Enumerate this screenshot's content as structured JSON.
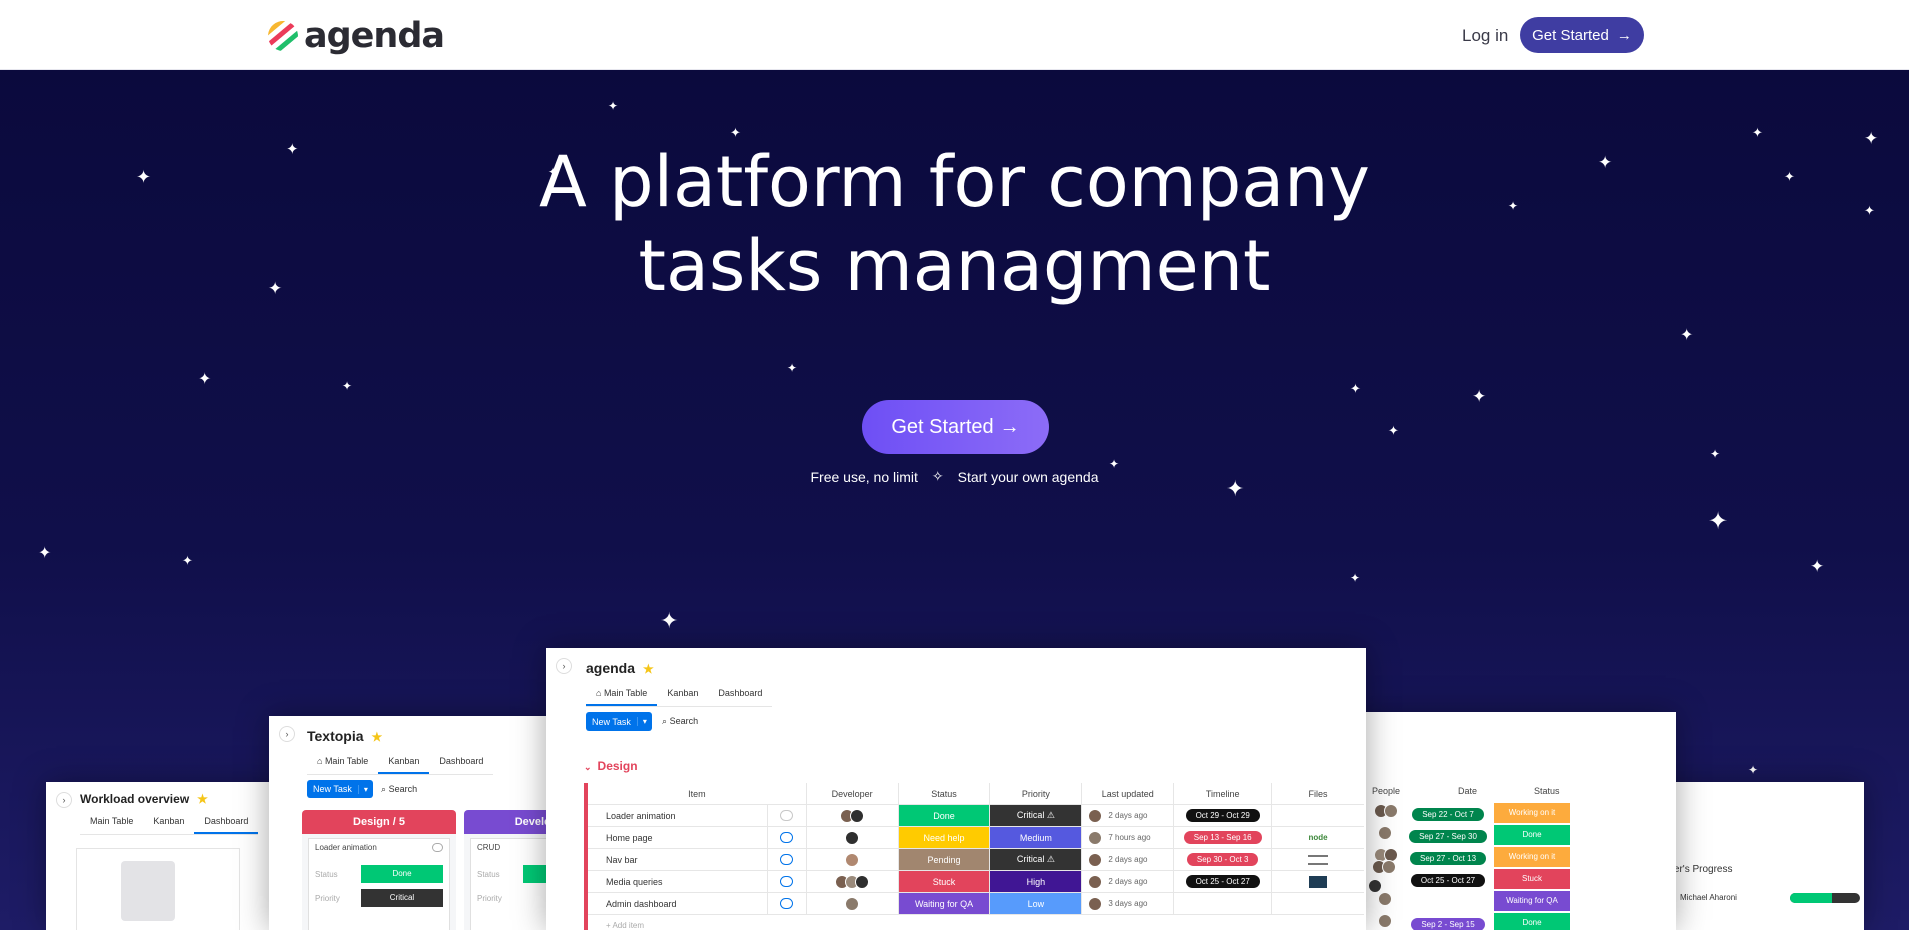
{
  "header": {
    "logo_text": "agenda",
    "login_label": "Log in",
    "cta_label": "Get Started",
    "cta_arrow": "→"
  },
  "hero": {
    "headline_line1": "A platform for company",
    "headline_line2": "tasks managment",
    "cta_label": "Get Started",
    "cta_arrow": "→",
    "sub_left": "Free use, no limit",
    "sub_right": "Start your own agenda"
  },
  "colors": {
    "hero_bg": "#0c0a3e",
    "brand_button": "#3f3da2",
    "hero_button": "#7557f6",
    "group_red": "#e2445c",
    "done_green": "#00c875",
    "stuck_red": "#e2445c",
    "working_orange": "#fdab3d",
    "qa_purple": "#784bd1",
    "critical_dark": "#333333"
  },
  "screen_main": {
    "title": "agenda",
    "tabs": [
      "Main Table",
      "Kanban",
      "Dashboard"
    ],
    "new_task": "New Task",
    "search": "Search",
    "group": "Design",
    "columns": [
      "Item",
      "Developer",
      "Status",
      "Priority",
      "Last updated",
      "Timeline",
      "Files"
    ],
    "rows": [
      {
        "item": "Loader animation",
        "status": "Done",
        "status_color": "#00c875",
        "priority": "Critical ⚠",
        "priority_color": "#333333",
        "updated": "2 days ago",
        "timeline": "Oct 29 - Oct 29",
        "timeline_color": "#111111",
        "file": ""
      },
      {
        "item": "Home page",
        "status": "Need help",
        "status_color": "#ffcb00",
        "priority": "Medium",
        "priority_color": "#5559df",
        "updated": "7 hours ago",
        "timeline": "Sep 13 - Sep 16",
        "timeline_color": "#e2445c",
        "file": "node"
      },
      {
        "item": "Nav bar",
        "status": "Pending",
        "status_color": "#a1866f",
        "priority": "Critical ⚠",
        "priority_color": "#333333",
        "updated": "2 days ago",
        "timeline": "Sep 30 - Oct 3",
        "timeline_color": "#e2445c",
        "file": ""
      },
      {
        "item": "Media queries",
        "status": "Stuck",
        "status_color": "#e2445c",
        "priority": "High",
        "priority_color": "#401694",
        "updated": "2 days ago",
        "timeline": "Oct 25 - Oct 27",
        "timeline_color": "#111111",
        "file": ""
      },
      {
        "item": "Admin dashboard",
        "status": "Waiting for QA",
        "status_color": "#784bd1",
        "priority": "Low",
        "priority_color": "#579bfc",
        "updated": "3 days ago",
        "timeline": "",
        "timeline_color": "",
        "file": ""
      }
    ],
    "add_item": "+ Add item"
  },
  "screen_kanban": {
    "title": "Textopia",
    "tabs": [
      "Main Table",
      "Kanban",
      "Dashboard"
    ],
    "new_task": "New Task",
    "search": "Search",
    "col1_header": "Design / 5",
    "col1_card": "Loader animation",
    "col1_status_label": "Status",
    "col1_status": "Done",
    "col1_priority_label": "Priority",
    "col1_priority": "Critical",
    "col2_header": "Developm",
    "col2_card": "CRUD",
    "col2_status_label": "Status",
    "col2_priority_label": "Priority"
  },
  "screen_workload": {
    "title": "Workload overview",
    "tabs": [
      "Main Table",
      "Kanban",
      "Dashboard"
    ]
  },
  "screen_right": {
    "columns": [
      "People",
      "Date",
      "Status"
    ],
    "rows": [
      {
        "date": "Sep 22 - Oct 7",
        "date_color": "#00854d",
        "status": "Working on it",
        "status_color": "#fdab3d"
      },
      {
        "date": "Sep 27 - Sep 30",
        "date_color": "#00854d",
        "status": "Done",
        "status_color": "#00c875"
      },
      {
        "date": "Sep 27 - Oct 13",
        "date_color": "#00854d",
        "status": "Working on it",
        "status_color": "#fdab3d"
      },
      {
        "date": "Oct 25 - Oct 27",
        "date_color": "#111111",
        "status": "Stuck",
        "status_color": "#e2445c"
      },
      {
        "date": "",
        "date_color": "",
        "status": "Waiting for QA",
        "status_color": "#784bd1"
      },
      {
        "date": "Sep 2 - Sep 15",
        "date_color": "#784bd1",
        "status": "Done",
        "status_color": "#00c875"
      }
    ]
  },
  "screen_far_right": {
    "heading": "mber's Progress",
    "member": "Michael Aharoni"
  }
}
